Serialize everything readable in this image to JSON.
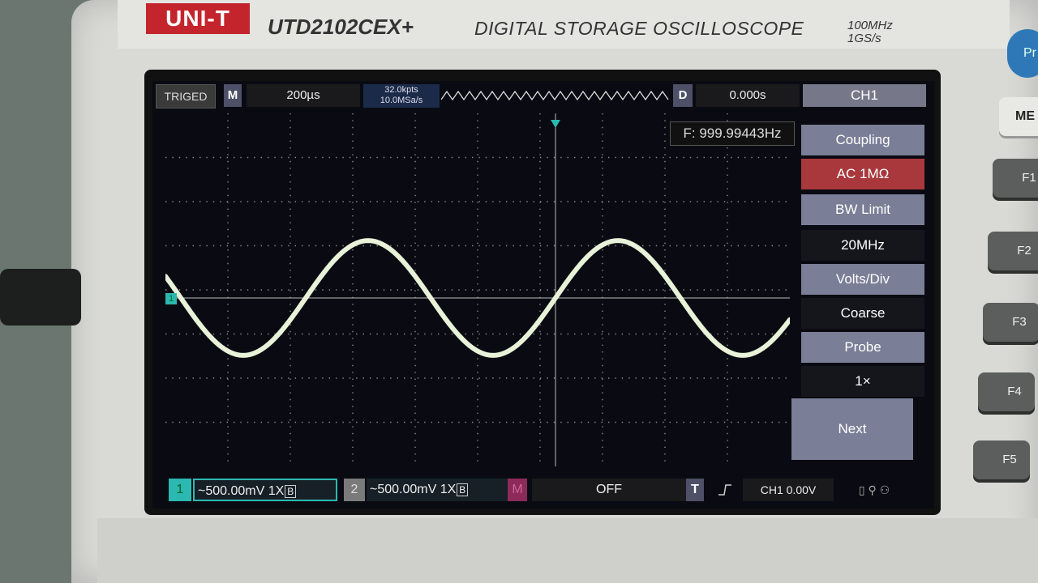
{
  "device": {
    "brand": "UNI-T",
    "model": "UTD2102CEX+",
    "description": "DIGITAL STORAGE OSCILLOSCOPE",
    "bandwidth": "100MHz",
    "sample_rate": "1GS/s",
    "pr_button": "Pr",
    "menu_button": "ME"
  },
  "topbar": {
    "trigger_status": "TRIGED",
    "m_label": "M",
    "timebase": "200µs",
    "memory_depth": "32.0kpts",
    "sampling": "10.0MSa/s",
    "d_label": "D",
    "delay": "0.000s",
    "menu_title": "CH1"
  },
  "measurement": {
    "frequency": "F: 999.99443Hz"
  },
  "menu": {
    "coupling_label": "Coupling",
    "coupling_value": "AC 1MΩ",
    "bw_label": "BW Limit",
    "bw_value": "20MHz",
    "volts_label": "Volts/Div",
    "volts_value": "Coarse",
    "probe_label": "Probe",
    "probe_value": "1×",
    "next_label": "Next"
  },
  "bottombar": {
    "ch1_number": "1",
    "ch1_setting": "~500.00mV  1X",
    "ch1_bw": "B",
    "ch2_number": "2",
    "ch2_setting": "~500.00mV  1X",
    "ch2_bw": "B",
    "math_label": "M",
    "math_value": "OFF",
    "trigger_label": "T",
    "trigger_setting": "CH1 0.00V"
  },
  "softkeys": [
    "F1",
    "F2",
    "F3",
    "F4",
    "F5"
  ],
  "trace": {
    "ch1_marker": "1",
    "color": "#e8f2d8",
    "frequency_hz": 999.99443,
    "cycles_visible": 2.5,
    "amplitude_divisions": 2.6
  },
  "colors": {
    "ch1": "#2bb8b0",
    "menu_header": "#7a7e96",
    "menu_selected": "#a8383c",
    "brand": "#c4242c"
  }
}
